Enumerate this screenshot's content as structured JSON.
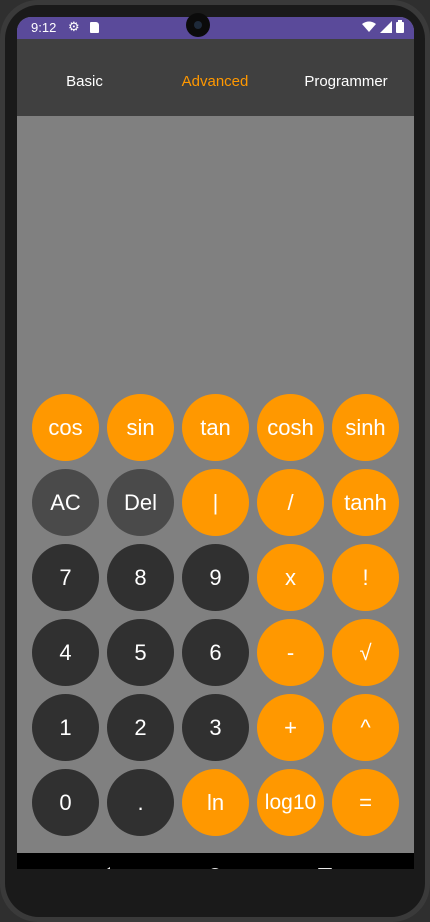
{
  "status": {
    "time": "9:12",
    "settings_icon": "gear-icon",
    "sd_icon": "sd-card-icon",
    "wifi_icon": "wifi-icon",
    "signal_icon": "signal-icon",
    "battery_icon": "battery-icon"
  },
  "tabs": [
    {
      "label": "Basic",
      "active": false
    },
    {
      "label": "Advanced",
      "active": true
    },
    {
      "label": "Programmer",
      "active": false
    }
  ],
  "display": {
    "value": ""
  },
  "colors": {
    "accent": "#ff9800",
    "key_dark": "#303030",
    "key_gray": "#4a4a4a",
    "display_bg": "#808080",
    "tab_bar_bg": "#404040"
  },
  "keys": [
    [
      "cos",
      "sin",
      "tan",
      "cosh",
      "sinh"
    ],
    [
      "AC",
      "Del",
      "|",
      "/",
      "tanh"
    ],
    [
      "7",
      "8",
      "9",
      "x",
      "!"
    ],
    [
      "4",
      "5",
      "6",
      "-",
      "√"
    ],
    [
      "1",
      "2",
      "3",
      "+",
      "^"
    ],
    [
      "0",
      ".",
      "ln",
      "log10",
      "="
    ]
  ],
  "navigation": {
    "back_icon": "back-triangle-icon",
    "home_icon": "home-circle-icon",
    "recents_icon": "recents-square-icon"
  }
}
